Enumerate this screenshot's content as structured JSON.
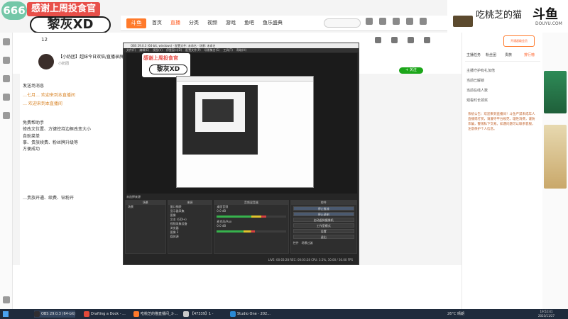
{
  "overlay": {
    "room_number": "666",
    "banner_title": "感谢上周投食官",
    "nickname": "黎灰XD",
    "streamer_name": "吃桃芝的猫",
    "brand": "斗鱼",
    "brand_sub": "DOUYU.COM"
  },
  "site": {
    "nav": [
      "首页",
      "直播",
      "分类",
      "视频",
      "游戏",
      "鱼吧",
      "鱼乐盛典"
    ],
    "active_nav": "直播"
  },
  "room": {
    "stat": "12",
    "title": "【小奶团】超妹今日双倍/直播录屏",
    "subtitle": "小奶团",
    "follow_label": "+ 关注"
  },
  "chat": {
    "lines": [
      {
        "text": "发送场消息",
        "style": "normal"
      },
      {
        "text": "…七月… 欢迎来到本直播间",
        "style": "orange"
      },
      {
        "text": "… 欢迎来到本直播间",
        "style": "orange"
      },
      {
        "text": "免费帮助手",
        "style": "normal"
      },
      {
        "text": "修改文位置、方键控持边框改变大小",
        "style": "normal"
      },
      {
        "text": "自助菜单",
        "style": "normal"
      },
      {
        "text": "事、贵族续费、粉丝牌升级等",
        "style": "normal"
      },
      {
        "text": "方便成功",
        "style": "normal"
      },
      {
        "text": "…贵族开通、续费、钻粉开",
        "style": "normal"
      }
    ]
  },
  "obs": {
    "title": "OBS 29.0.3 (64-bit, windows) - 配置文件: 未命名 - 场景: 未命名",
    "menu": [
      "文件(F)",
      "编辑(E)",
      "视图(V)",
      "停靠窗口(D)",
      "配置文件(P)",
      "场景集合(S)",
      "工具(T)",
      "帮助(H)"
    ],
    "stamp_title": "感谢上周投食官",
    "stamp_nick": "黎灰XD",
    "scene_bar": "未选择来源",
    "docks": {
      "scenes_header": "场景",
      "scene_item": "场景",
      "sources_header": "来源",
      "sources": [
        "窗口捕获",
        "显示器采集",
        "图像",
        "文本 (GDI+)",
        "视频采集设备",
        "浏览器",
        "图像 2",
        "媒体源"
      ],
      "mixer_header": "音频混音器",
      "mixer": [
        {
          "name": "桌面音频",
          "db": "0.0 dB",
          "level": 0.72
        },
        {
          "name": "麦克风/Aux",
          "db": "0.0 dB",
          "level": 0.55
        }
      ],
      "controls_header": "控件",
      "controls": [
        "停止推流",
        "停止录制",
        "启动虚拟摄像机",
        "工作室模式",
        "设置",
        "退出"
      ],
      "controls_active": [
        true,
        true,
        false,
        false,
        false,
        false
      ],
      "transition_tabs": [
        "控件",
        "场景过渡"
      ]
    },
    "status": "LIVE: 00:03:28   REC: 00:03:28   CPU: 3.5%, 30.00 / 30.00 FPS"
  },
  "right": {
    "tabs": [
      "主播任务",
      "粉丝团",
      "贵族",
      "排行榜"
    ],
    "prize_label": "开通超级会员",
    "entries": [
      "主播守护有礼加倍",
      "当前已解锁",
      "当前在线人数",
      "观看时长领奖"
    ],
    "notice": "系统公告：欢迎来到直播间！斗鱼严禁未成年人直播或打赏，请遵守平台规范，理性消费，谨防诈骗，警惕私下交易。如遇问题可以联系客服，注意保护个人信息。"
  },
  "taskbar": {
    "items": [
      {
        "label": "OBS 29.0.3 (64-bit)",
        "color": "#302e31",
        "active": true
      },
      {
        "label": "Drafting a Dock - ...",
        "color": "#e34a3a",
        "active": false
      },
      {
        "label": "吃桃芝的猫直播间_斗...",
        "color": "#ff7a2b",
        "active": false
      },
      {
        "label": "【47339】1 -",
        "color": "#c9c9c9",
        "active": false
      },
      {
        "label": "Studio One - 202...",
        "color": "#2a8ad6",
        "active": false
      }
    ],
    "weather": "26°C 晴朗",
    "time": "19:52:41",
    "date": "2023/11/27"
  },
  "colors": {
    "accent": "#ff5d23",
    "live_green": "#1ca61a",
    "notice": "#c0612a"
  }
}
